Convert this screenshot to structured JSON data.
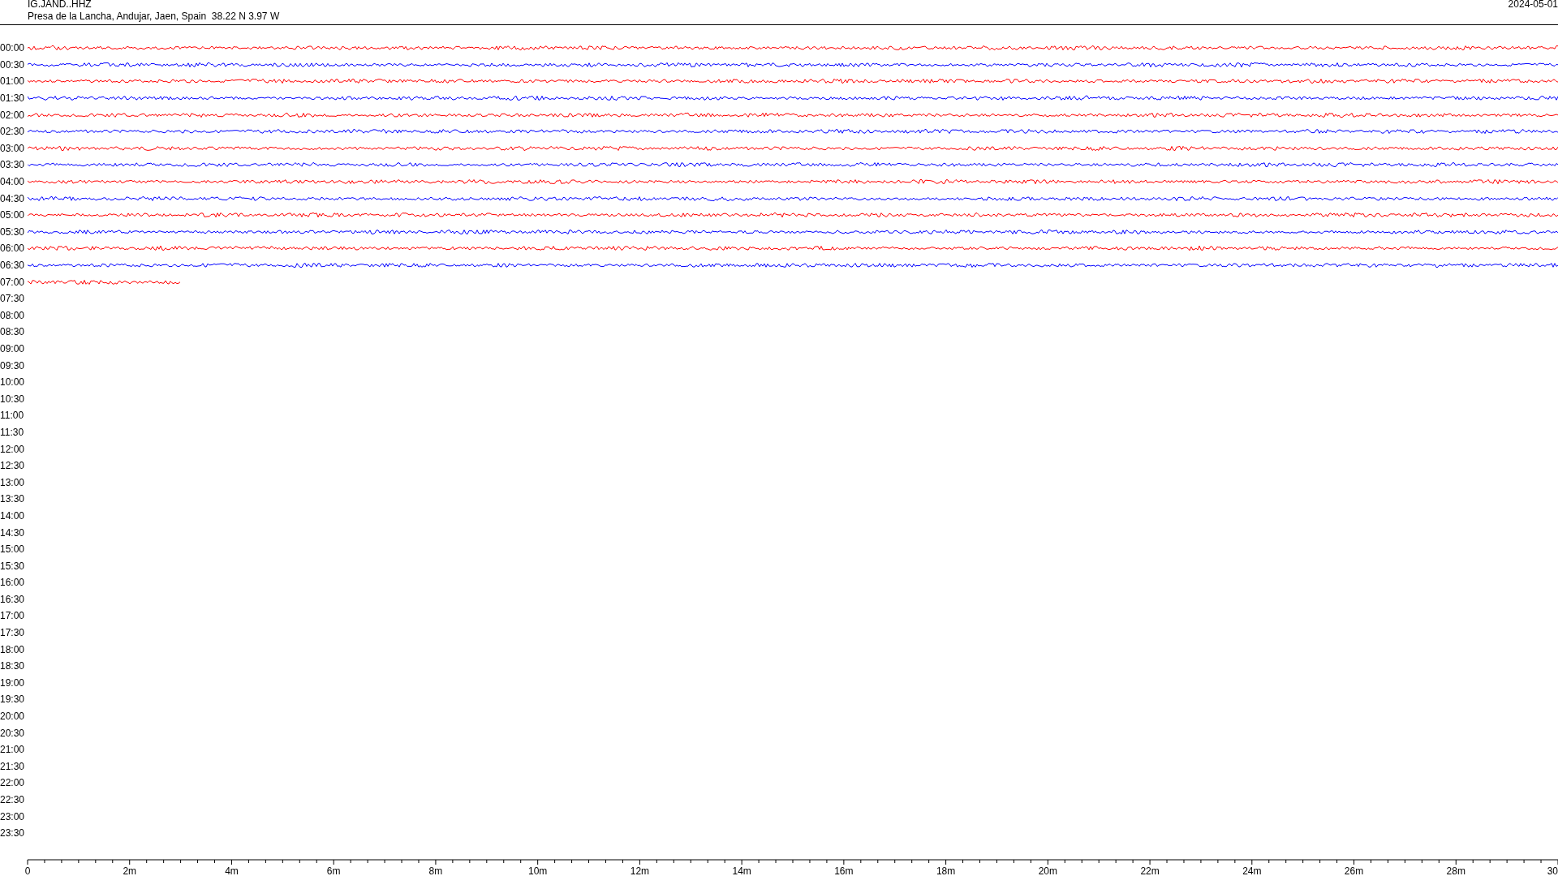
{
  "header": {
    "station": "IG.JAND..HHZ",
    "location": "Presa de la Lancha, Andujar, Jaen, Spain  38.22 N 3.97 W",
    "date": "2024-05-01"
  },
  "rows": [
    {
      "label": "00:00",
      "kind": "full",
      "color": "#ff0000"
    },
    {
      "label": "00:30",
      "kind": "full",
      "color": "#0000ff"
    },
    {
      "label": "01:00",
      "kind": "full",
      "color": "#ff0000"
    },
    {
      "label": "01:30",
      "kind": "full",
      "color": "#0000ff"
    },
    {
      "label": "02:00",
      "kind": "full",
      "color": "#ff0000"
    },
    {
      "label": "02:30",
      "kind": "full",
      "color": "#0000ff"
    },
    {
      "label": "03:00",
      "kind": "full",
      "color": "#ff0000"
    },
    {
      "label": "03:30",
      "kind": "full",
      "color": "#0000ff"
    },
    {
      "label": "04:00",
      "kind": "full",
      "color": "#ff0000"
    },
    {
      "label": "04:30",
      "kind": "full",
      "color": "#0000ff"
    },
    {
      "label": "05:00",
      "kind": "full",
      "color": "#ff0000"
    },
    {
      "label": "05:30",
      "kind": "full",
      "color": "#0000ff"
    },
    {
      "label": "06:00",
      "kind": "full",
      "color": "#ff0000"
    },
    {
      "label": "06:30",
      "kind": "full",
      "color": "#0000ff"
    },
    {
      "label": "07:00",
      "kind": "partial",
      "color": "#ff0000"
    },
    {
      "label": "07:30",
      "kind": "empty"
    },
    {
      "label": "08:00",
      "kind": "empty"
    },
    {
      "label": "08:30",
      "kind": "empty"
    },
    {
      "label": "09:00",
      "kind": "empty"
    },
    {
      "label": "09:30",
      "kind": "empty"
    },
    {
      "label": "10:00",
      "kind": "empty"
    },
    {
      "label": "10:30",
      "kind": "empty"
    },
    {
      "label": "11:00",
      "kind": "empty"
    },
    {
      "label": "11:30",
      "kind": "empty"
    },
    {
      "label": "12:00",
      "kind": "empty"
    },
    {
      "label": "12:30",
      "kind": "empty"
    },
    {
      "label": "13:00",
      "kind": "empty"
    },
    {
      "label": "13:30",
      "kind": "empty"
    },
    {
      "label": "14:00",
      "kind": "empty"
    },
    {
      "label": "14:30",
      "kind": "empty"
    },
    {
      "label": "15:00",
      "kind": "empty"
    },
    {
      "label": "15:30",
      "kind": "empty"
    },
    {
      "label": "16:00",
      "kind": "empty"
    },
    {
      "label": "16:30",
      "kind": "empty"
    },
    {
      "label": "17:00",
      "kind": "empty"
    },
    {
      "label": "17:30",
      "kind": "empty"
    },
    {
      "label": "18:00",
      "kind": "empty"
    },
    {
      "label": "18:30",
      "kind": "empty"
    },
    {
      "label": "19:00",
      "kind": "empty"
    },
    {
      "label": "19:30",
      "kind": "empty"
    },
    {
      "label": "20:00",
      "kind": "empty"
    },
    {
      "label": "20:30",
      "kind": "empty"
    },
    {
      "label": "21:00",
      "kind": "empty"
    },
    {
      "label": "21:30",
      "kind": "empty"
    },
    {
      "label": "22:00",
      "kind": "empty"
    },
    {
      "label": "22:30",
      "kind": "empty"
    },
    {
      "label": "23:00",
      "kind": "empty"
    },
    {
      "label": "23:30",
      "kind": "empty"
    }
  ],
  "axis": {
    "labels": [
      "0",
      "2m",
      "4m",
      "6m",
      "8m",
      "10m",
      "12m",
      "14m",
      "16m",
      "18m",
      "20m",
      "22m",
      "24m",
      "26m",
      "28m",
      "30"
    ]
  }
}
